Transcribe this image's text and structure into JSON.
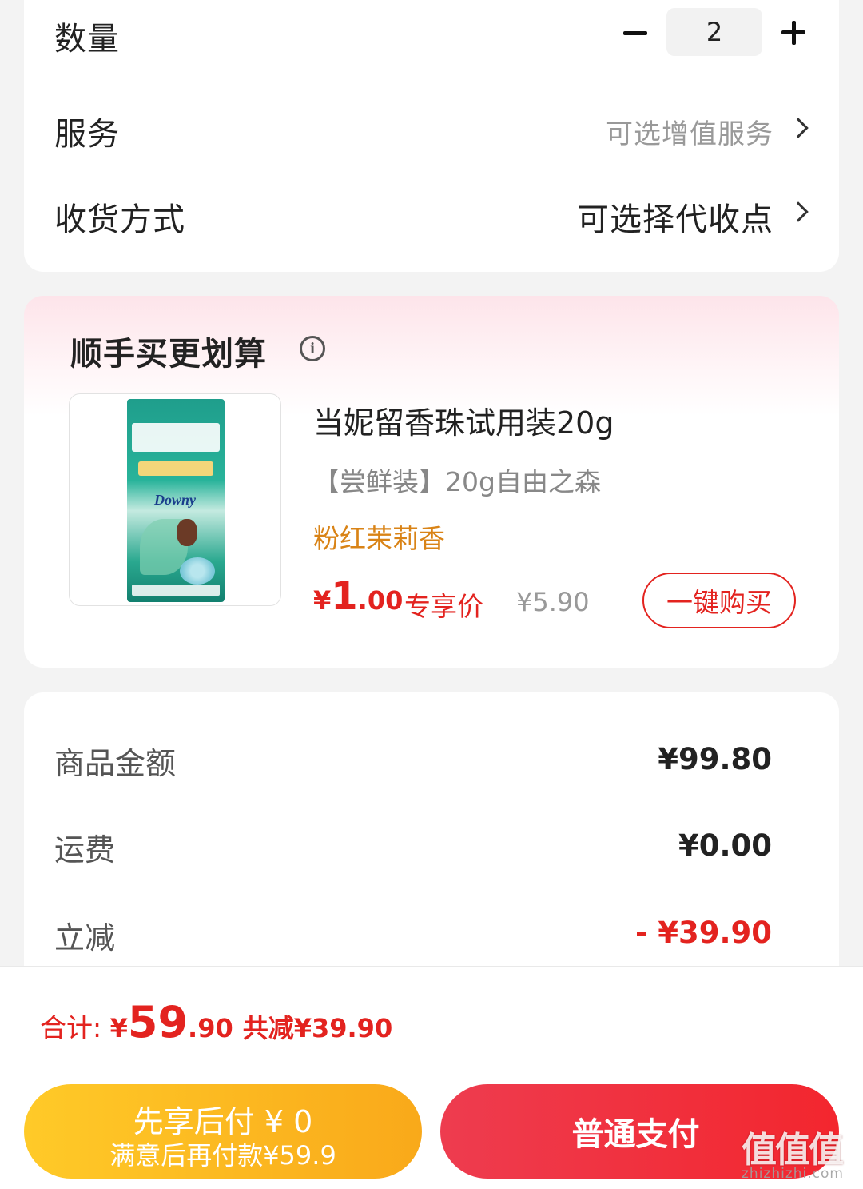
{
  "order": {
    "quantity_label": "数量",
    "quantity_value": "2",
    "service_label": "服务",
    "service_value": "可选增值服务",
    "delivery_label": "收货方式",
    "delivery_value": "可选择代收点"
  },
  "upsell": {
    "title": "顺手买更划算",
    "product": {
      "image_brand": "Downy",
      "title": "当妮留香珠试用装20g",
      "spec": "【尝鲜装】20g自由之森",
      "scent": "粉红茉莉香",
      "price_symbol": "¥",
      "price_int": "1",
      "price_dec": ".00",
      "price_tag": "专享价",
      "original_price": "¥5.90",
      "buy_button": "一键购买"
    }
  },
  "amounts": {
    "goods_label": "商品金额",
    "goods_value": "¥99.80",
    "shipping_label": "运费",
    "shipping_value": "¥0.00",
    "discount_label": "立减",
    "discount_value": "- ¥39.90"
  },
  "total": {
    "label": "合计: ",
    "symbol": "¥",
    "int": "59",
    "dec": ".90",
    "saved": "共减¥39.90"
  },
  "actions": {
    "pay_later_line1": "先享后付 ¥ 0",
    "pay_later_line2": "满意后再付款¥59.9",
    "pay_normal": "普通支付"
  },
  "watermark": {
    "text": "值值值",
    "url": "zhizhizhi.com"
  },
  "colors": {
    "accent_red": "#e3231f",
    "scent_orange": "#d98316",
    "pay_later_yellow": "#f9a91a",
    "pay_red": "#f3262e"
  }
}
